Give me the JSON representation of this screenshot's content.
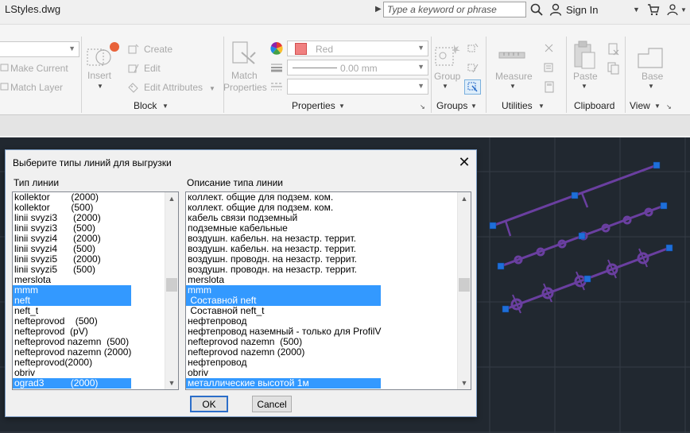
{
  "titlebar": {
    "document_title": "LStyles.dwg",
    "search_placeholder": "Type a keyword or phrase",
    "sign_in_label": "Sign In",
    "icons": [
      "search-icon",
      "person-icon",
      "cart-icon",
      "user-group-icon"
    ]
  },
  "ribbon": {
    "layers": {
      "make_current_label": "Make Current",
      "match_layer_label": "Match Layer"
    },
    "block": {
      "insert_label": "Insert",
      "create_label": "Create",
      "edit_label": "Edit",
      "edit_attributes_label": "Edit Attributes",
      "group_label": "Block"
    },
    "properties": {
      "match_properties_line1": "Match",
      "match_properties_line2": "Properties",
      "color_value": "Red",
      "color_hex": "#f08080",
      "lineweight_value": "0.00 mm",
      "group_label": "Properties"
    },
    "groups": {
      "group_button_label": "Group",
      "group_label": "Groups"
    },
    "utilities": {
      "measure_label": "Measure",
      "group_label": "Utilities"
    },
    "clipboard": {
      "paste_label": "Paste",
      "group_label": "Clipboard"
    },
    "view": {
      "base_label": "Base",
      "group_label": "View"
    }
  },
  "dialog": {
    "title": "Выберите типы линий для выгрузки",
    "col_types_header": "Тип линии",
    "col_desc_header": "Описание типа линии",
    "ok_label": "OK",
    "cancel_label": "Cancel",
    "selection_color": "#3399ff",
    "types": [
      {
        "text": "kollektor        (2000)",
        "selected": false
      },
      {
        "text": "kollektor        (500)",
        "selected": false
      },
      {
        "text": "linii svyzi3      (2000)",
        "selected": false
      },
      {
        "text": "linii svyzi3      (500)",
        "selected": false
      },
      {
        "text": "linii svyzi4      (2000)",
        "selected": false
      },
      {
        "text": "linii svyzi4      (500)",
        "selected": false
      },
      {
        "text": "linii svyzi5      (2000)",
        "selected": false
      },
      {
        "text": "linii svyzi5      (500)",
        "selected": false
      },
      {
        "text": "merslota",
        "selected": false
      },
      {
        "text": "mmm",
        "selected": true
      },
      {
        "text": "neft",
        "selected": true
      },
      {
        "text": "neft_t",
        "selected": false
      },
      {
        "text": "nefteprovod    (500)",
        "selected": false
      },
      {
        "text": "nefteprovod  (pV)",
        "selected": false
      },
      {
        "text": "nefteprovod nazemn  (500)",
        "selected": false
      },
      {
        "text": "nefteprovod nazemn (2000)",
        "selected": false
      },
      {
        "text": "nefteprovod(2000)",
        "selected": false
      },
      {
        "text": "obriv",
        "selected": false
      },
      {
        "text": "ograd3          (2000)",
        "selected": true
      }
    ],
    "descriptions": [
      {
        "text": "коллект. общие для подзем. ком.",
        "selected": false
      },
      {
        "text": "коллект. общие для подзем. ком.",
        "selected": false
      },
      {
        "text": "кабель связи подземный",
        "selected": false
      },
      {
        "text": "подземные кабельные",
        "selected": false
      },
      {
        "text": "воздушн. кабельн. на незастр. террит.",
        "selected": false
      },
      {
        "text": "воздушн. кабельн. на незастр. террит.",
        "selected": false
      },
      {
        "text": "воздушн. проводн. на незастр. террит.",
        "selected": false
      },
      {
        "text": "воздушн. проводн. на незастр. террит.",
        "selected": false
      },
      {
        "text": "merslota",
        "selected": false
      },
      {
        "text": "mmm",
        "selected": true
      },
      {
        "text": " Составной neft",
        "selected": true
      },
      {
        "text": " Составной neft_t",
        "selected": false
      },
      {
        "text": "нефтепровод",
        "selected": false
      },
      {
        "text": "нефтепровод наземный - только для ProfilV",
        "selected": false
      },
      {
        "text": "nefteprovod nazemn  (500)",
        "selected": false
      },
      {
        "text": "nefteprovod nazemn (2000)",
        "selected": false
      },
      {
        "text": "нефтепровод",
        "selected": false
      },
      {
        "text": "obriv",
        "selected": false
      },
      {
        "text": "металлические высотой 1м",
        "selected": true
      }
    ]
  },
  "viewport": {
    "background": "#212830",
    "line_color": "#6a3fa0",
    "grip_color": "#1e6fd9"
  }
}
